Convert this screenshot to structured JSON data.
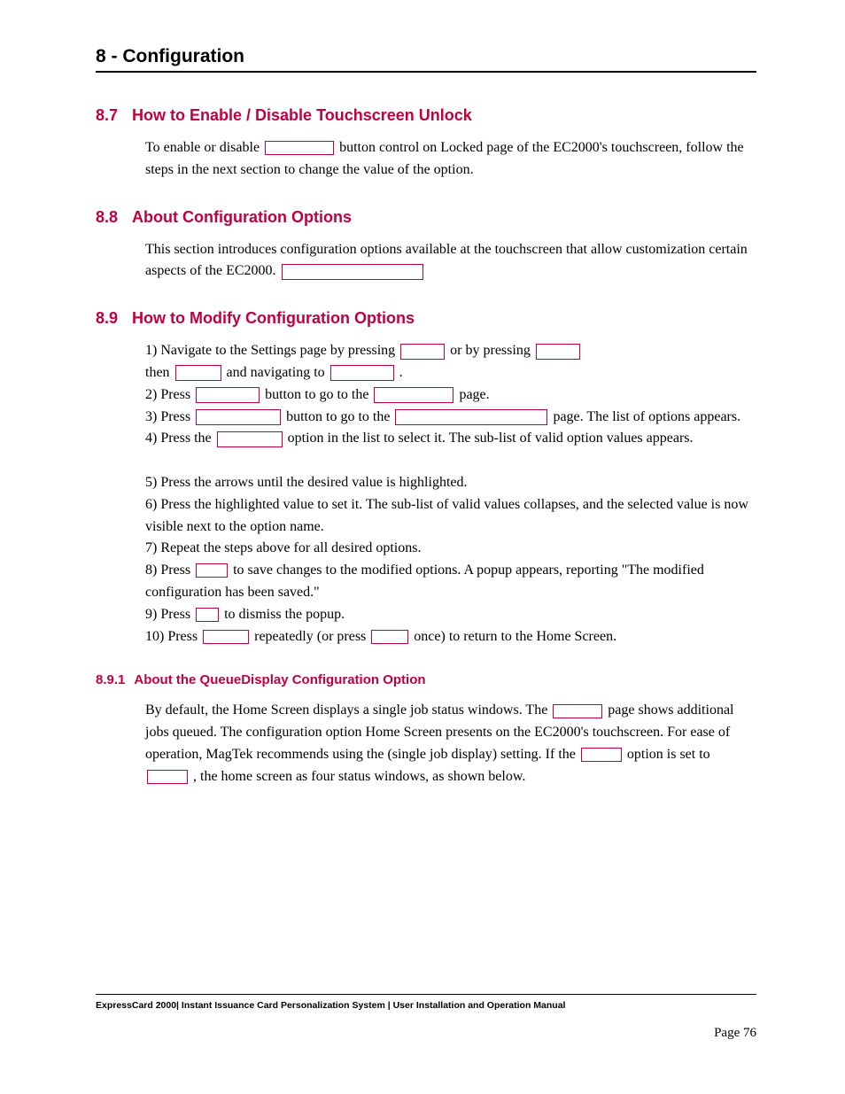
{
  "chapter": "8 - Configuration",
  "sections": {
    "s87": {
      "num": "8.7",
      "title": "How to Enable / Disable Touchscreen Unlock",
      "body_html": "To enable or disable <span class='inline-box' style='width:78px;height:16px;'></span> button control on Locked page of the EC2000's touchscreen, follow the steps in the next section to change the value of the option."
    },
    "s88": {
      "num": "8.8",
      "title": "About Configuration Options",
      "body_html": "This section introduces configuration options available at the touchscreen that allow customization certain aspects of the EC2000. <span class='inline-box' style='width:160px;height:18px;'></span>"
    },
    "s89": {
      "num": "8.9",
      "title": "How to Modify Configuration Options",
      "body_html": "1) Navigate to the Settings page by pressing <span class='inline-box' style='width:50px;height:18px;'></span> or by pressing <span class='inline-box' style='width:50px;height:18px;'></span><br>then <span class='inline-box' style='width:52px;height:18px;'></span> and navigating to <span class='inline-box' style='width:72px;height:18px;'></span> .<br>2) Press <span class='inline-box' style='width:72px;height:18px;'></span> button to go to the <span class='inline-box' style='width:90px;height:18px;'></span> page.<br>3) Press <span class='inline-box' style='width:96px;height:18px;'></span> button to go to the <span class='inline-box' style='width:172px;height:18px;'></span> page. The list of options appears.<br>4) Press the <span class='inline-box' style='width:74px;height:18px;'></span> option in the list to select it. The sub-list of valid option values appears.<br><br>5) Press the arrows until the desired value is highlighted.<br>6) Press the highlighted value to set it. The sub-list of valid values collapses, and the selected value is now visible next to the option name.<br>7) Repeat the steps above for all desired options.<br>8) Press <span class='inline-box' style='width:36px;height:16px;'></span> to save changes to the modified options. A popup appears, reporting \"The modified configuration has been saved.\"<br>9) Press <span class='inline-box' style='width:26px;height:16px;'></span> to dismiss the popup.<br>10) Press <span class='inline-box' style='width:52px;height:16px;'></span> repeatedly (or press <span class='inline-box' style='width:42px;height:16px;'></span> once) to return to the Home Screen."
    },
    "s891": {
      "num": "8.9.1",
      "title": "About the QueueDisplay Configuration Option",
      "body_html": "By default, the Home Screen displays a single job status windows. The <span class='inline-box' style='width:56px;height:16px;'></span> page shows additional jobs queued. The configuration option Home Screen presents on the EC2000's touchscreen. For ease of operation, MagTek recommends using the (single job display) setting. If the <span class='inline-box' style='width:46px;height:16px;'></span> option is set to <span class='inline-box' style='width:46px;height:16px;'></span> , the home screen as four status windows, as shown below."
    }
  },
  "footer": "ExpressCard 2000| Instant Issuance Card Personalization System | User Installation and Operation Manual",
  "page_number": "Page 76"
}
